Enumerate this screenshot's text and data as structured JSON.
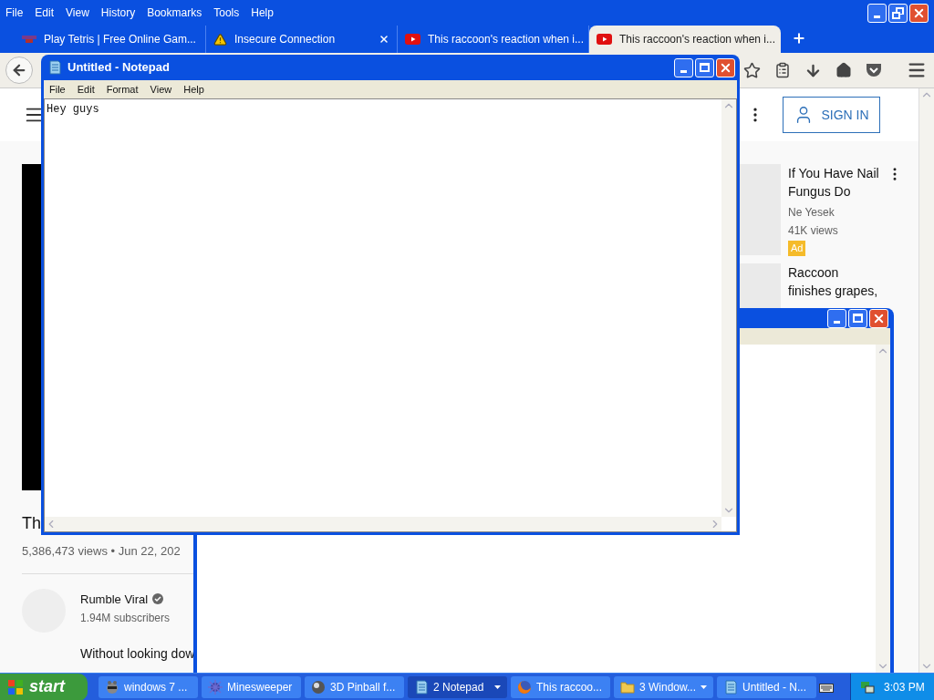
{
  "browser": {
    "menu": [
      "File",
      "Edit",
      "View",
      "History",
      "Bookmarks",
      "Tools",
      "Help"
    ],
    "tabs": [
      {
        "title": "Play Tetris | Free Online Gam...",
        "kind": "game",
        "selected": false
      },
      {
        "title": "Insecure Connection",
        "kind": "warning",
        "selected": false
      },
      {
        "title": "This raccoon's reaction when i...",
        "kind": "video",
        "selected": false
      },
      {
        "title": "This raccoon's reaction when i...",
        "kind": "video",
        "selected": true
      }
    ]
  },
  "page": {
    "sign_in": "SIGN IN",
    "video": {
      "title": "Th",
      "meta": "5,386,473 views • Jun 22, 202",
      "channel": "Rumble Viral",
      "subscribers": "1.94M subscribers",
      "description": "Without looking dow"
    },
    "related": [
      {
        "title": "If You Have Nail Fungus Do",
        "channel": "Ne Yesek",
        "views": "41K views",
        "badge": "Ad"
      },
      {
        "title": "Raccoon finishes grapes,"
      }
    ]
  },
  "notepad": {
    "title": "Untitled - Notepad",
    "menu": [
      "File",
      "Edit",
      "Format",
      "View",
      "Help"
    ],
    "text": "Hey guys"
  },
  "taskbar": {
    "start": "start",
    "items": [
      {
        "label": "windows 7 ...",
        "kind": "raccoon",
        "selected": false,
        "group": false
      },
      {
        "label": "Minesweeper",
        "kind": "mine",
        "selected": false,
        "group": false
      },
      {
        "label": "3D Pinball f...",
        "kind": "pinball",
        "selected": false,
        "group": false
      },
      {
        "label": "2 Notepad",
        "kind": "notepad",
        "selected": true,
        "group": true
      },
      {
        "label": "This raccoo...",
        "kind": "firefox",
        "selected": false,
        "group": false
      },
      {
        "label": "3 Window...",
        "kind": "folder",
        "selected": false,
        "group": true
      },
      {
        "label": "Untitled - N...",
        "kind": "notepad",
        "selected": false,
        "group": false
      }
    ],
    "clock": "3:03 PM"
  }
}
